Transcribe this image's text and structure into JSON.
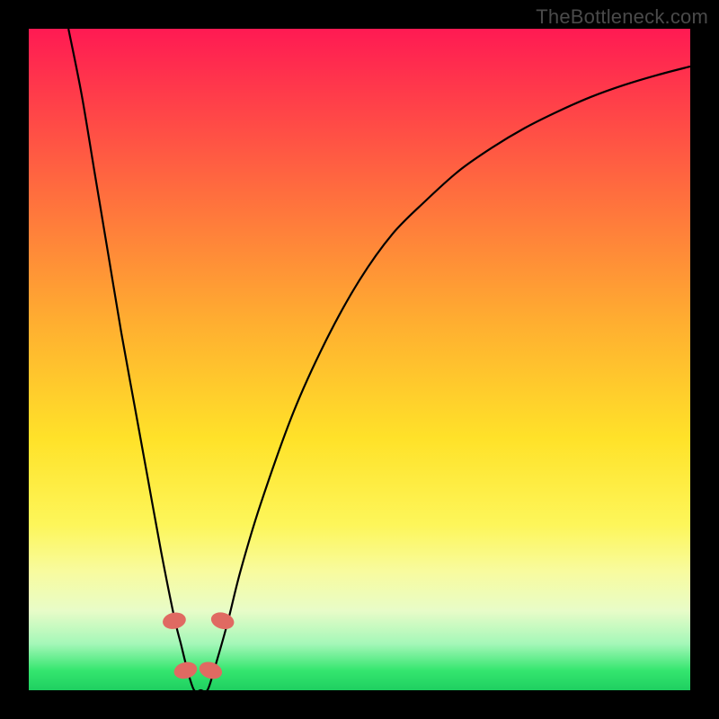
{
  "watermark": "TheBottleneck.com",
  "chart_data": {
    "type": "line",
    "title": "",
    "xlabel": "",
    "ylabel": "",
    "xlim": [
      0,
      100
    ],
    "ylim": [
      0,
      100
    ],
    "gradient_note": "background encodes bottleneck severity: red (top) = high, green (bottom) = 0",
    "series": [
      {
        "name": "bottleneck-curve",
        "x": [
          6,
          8,
          10,
          12,
          14,
          16,
          18,
          20,
          22,
          23,
          24,
          25,
          26,
          27,
          28,
          30,
          32,
          35,
          40,
          45,
          50,
          55,
          60,
          65,
          70,
          75,
          80,
          85,
          90,
          95,
          100
        ],
        "values": [
          100,
          90,
          78,
          66,
          54,
          43,
          32,
          21,
          11,
          7,
          3,
          0,
          0,
          0,
          3,
          10,
          18,
          28,
          42,
          53,
          62,
          69,
          74,
          78.5,
          82,
          85,
          87.5,
          89.7,
          91.5,
          93,
          94.3
        ]
      }
    ],
    "markers": [
      {
        "name": "marker-left-upper",
        "x": 22.0,
        "y": 10.5
      },
      {
        "name": "marker-left-lower",
        "x": 23.7,
        "y": 3.0
      },
      {
        "name": "marker-right-lower",
        "x": 27.5,
        "y": 3.0
      },
      {
        "name": "marker-right-upper",
        "x": 29.3,
        "y": 10.5
      }
    ],
    "marker_style": {
      "fill": "#e06a62",
      "rx": 9,
      "ry": 13,
      "angle_follows_curve": true
    }
  }
}
